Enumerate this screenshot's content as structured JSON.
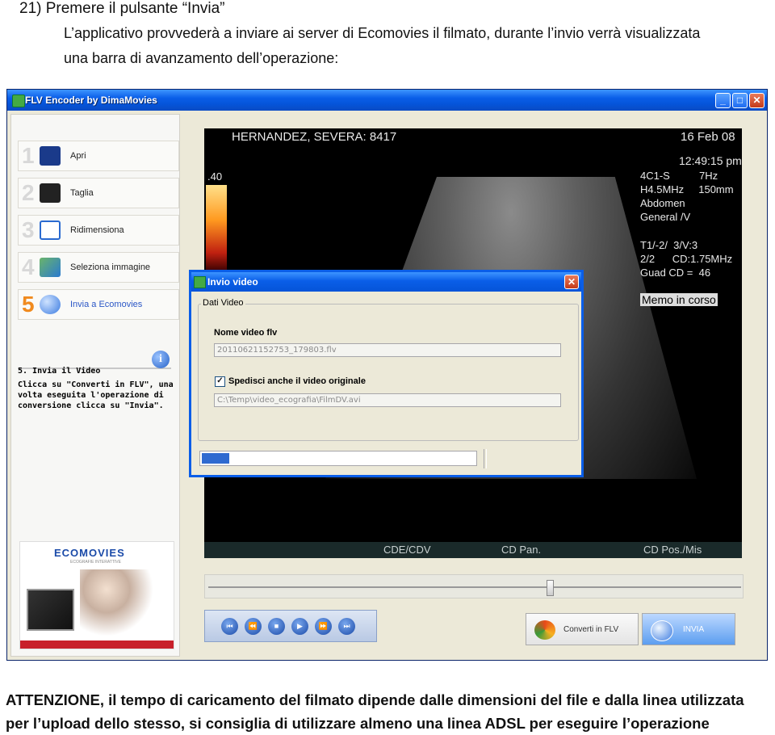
{
  "doc": {
    "step_heading": "21) Premere il pulsante “Invia”",
    "desc_line1": "L’applicativo provvederà a inviare ai server di Ecomovies il filmato, durante l’invio verrà visualizzata",
    "desc_line2": "una barra di avanzamento dell’operazione:",
    "warning_line1": "ATTENZIONE, il tempo di caricamento del filmato dipende dalle dimensioni del file e dalla linea utilizzata",
    "warning_line2": "per l’upload dello stesso, si consiglia di utilizzare almeno una linea ADSL per eseguire l’operazione"
  },
  "app": {
    "title": "FLV Encoder by DimaMovies",
    "window_buttons": {
      "minimize": "_",
      "maximize": "□",
      "close": "✕"
    },
    "steps": [
      {
        "num": "1",
        "label": "Apri",
        "icon": "film-icon",
        "color": "#1a3a8a"
      },
      {
        "num": "2",
        "label": "Taglia",
        "icon": "clapperboard-icon",
        "color": "#222222"
      },
      {
        "num": "3",
        "label": "Ridimensiona",
        "icon": "crop-icon",
        "color": "#2a6ad0"
      },
      {
        "num": "4",
        "label": "Seleziona immagine",
        "icon": "image-icon",
        "color": "#4a9a4a"
      },
      {
        "num": "5",
        "label": "Invia a Ecomovies",
        "icon": "globe-icon",
        "color": "#3a7ae0",
        "active": true
      }
    ],
    "info": {
      "title": "5. Invia il Video",
      "text": "Clicca su \"Converti in FLV\", una\nvolta eseguita l'operazione di\nconversione clicca su \"Invia\".",
      "icon": "info-icon"
    },
    "ad": {
      "logo": "ECOMOVIES",
      "tagline": "ECOGRAFIE INTERATTIVE"
    },
    "video": {
      "patient": "HERNANDEZ, SEVERA: 8417",
      "date": "16 Feb 08",
      "time": "12:49:15 pm",
      "scale_top": ".40",
      "params": "4C1-S          7Hz\nH4.5MHz     150mm\nAbdomen\nGeneral /V",
      "params2": "T1/-2/  3/V:3\n2/2      CD:1.75MHz\nGuad CD =  46",
      "status": "Memo in corso",
      "bottom_labels": [
        "CDE/CDV",
        "CD Pan.",
        "CD Pos./Mis"
      ]
    },
    "dialog": {
      "title": "Invio video",
      "group_label": "Dati Video",
      "filename_label": "Nome video flv",
      "filename_value": "20110621152753_179803.flv",
      "checkbox_label": "Spedisci anche il video originale",
      "checkbox_checked": true,
      "original_path": "C:\\Temp\\video_ecografia\\FilmDV.avi",
      "progress": 0.1
    },
    "slider": {
      "position": 0.64
    },
    "controls": [
      "first-icon",
      "rewind-icon",
      "stop-icon",
      "play-icon",
      "forward-icon",
      "last-icon"
    ],
    "buttons": {
      "convert": "Converti in FLV",
      "send": "INVIA"
    }
  }
}
